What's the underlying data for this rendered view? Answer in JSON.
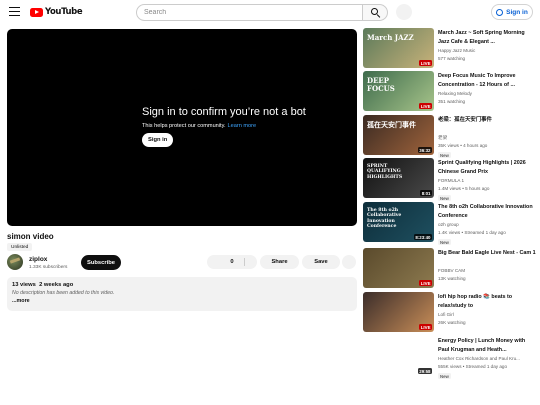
{
  "header": {
    "brand": "YouTube",
    "search_placeholder": "Search",
    "signin_label": "Sign in"
  },
  "player": {
    "title": "Sign in to confirm you’re not a bot",
    "subtitle": "This helps protect our community.",
    "learn_more": "Learn more",
    "signin_label": "Sign in"
  },
  "video": {
    "title": "simon video",
    "visibility": "Unlisted",
    "channel": "ziplox",
    "subscribers": "1.33K subscribers",
    "subscribe_label": "Subscribe",
    "likes": "0",
    "share_label": "Share",
    "save_label": "Save",
    "views": "13 views",
    "age": "2 weeks ago",
    "description": "No description has been added to this video.",
    "more_label": "...more"
  },
  "recommendations": [
    {
      "title": "March Jazz ~ Soft Spring Morning Jazz Cafe & Elegant ...",
      "channel": "Happy Jazz Music",
      "meta": "577 watching",
      "badge": "LIVE",
      "new": "",
      "thumb_text": "March JAZZ",
      "thumb_colors": [
        "#5b7a5a",
        "#c9b27a"
      ]
    },
    {
      "title": "Deep Focus Music To Improve Concentration - 12 Hours of ...",
      "channel": "Relaxing Melody",
      "meta": "351 watching",
      "badge": "LIVE",
      "new": "",
      "thumb_text": "DEEP FOCUS",
      "thumb_colors": [
        "#3e6b4c",
        "#a7c48a"
      ]
    },
    {
      "title": "老梁：孤在天安门事件",
      "channel": "老梁",
      "meta": "35K views • 4 hours ago",
      "badge": "36:32",
      "new": "New",
      "thumb_text": "孤在天安门事件",
      "thumb_colors": [
        "#3a2a22",
        "#a0643c"
      ]
    },
    {
      "title": "Sprint Qualifying Highlights | 2026 Chinese Grand Prix",
      "channel": "FORMULA 1",
      "meta": "1.4M views • 5 hours ago",
      "badge": "8:01",
      "new": "New",
      "thumb_text": "SPRINT QUALIFYING HIGHLIGHTS",
      "thumb_colors": [
        "#111111",
        "#4a4a4a"
      ]
    },
    {
      "title": "The 8th o2h Collaborative Innovation Conference",
      "channel": "o2h group",
      "meta": "1.4K views • Streamed 1 day ago",
      "badge": "8:23:40",
      "new": "New",
      "thumb_text": "The 8th o2h Collaborative Innovation Conference",
      "thumb_colors": [
        "#0d2d3a",
        "#1f5060"
      ]
    },
    {
      "title": "Big Bear Bald Eagle Live Nest - Cam 1",
      "channel": "FOBBV CAM",
      "meta": "13K watching",
      "badge": "LIVE",
      "new": "",
      "thumb_text": "",
      "thumb_colors": [
        "#5a4a2c",
        "#8d7a4f"
      ]
    },
    {
      "title": "lofi hip hop radio 📚 beats to relax/study to",
      "channel": "Lofi Girl",
      "meta": "26K watching",
      "badge": "LIVE",
      "new": "",
      "thumb_text": "",
      "thumb_colors": [
        "#3b2d2a",
        "#c98e58"
      ]
    },
    {
      "title": "Energy Policy | Lunch Money with Paul Krugman and Heath...",
      "channel": "Heather Cox Richardson and Paul Kru...",
      "meta": "555K views • Streamed 1 day ago",
      "badge": "29:58",
      "new": "New",
      "thumb_text": "",
      "thumb_colors": [
        "#ffffff",
        "#ffffff"
      ]
    }
  ]
}
